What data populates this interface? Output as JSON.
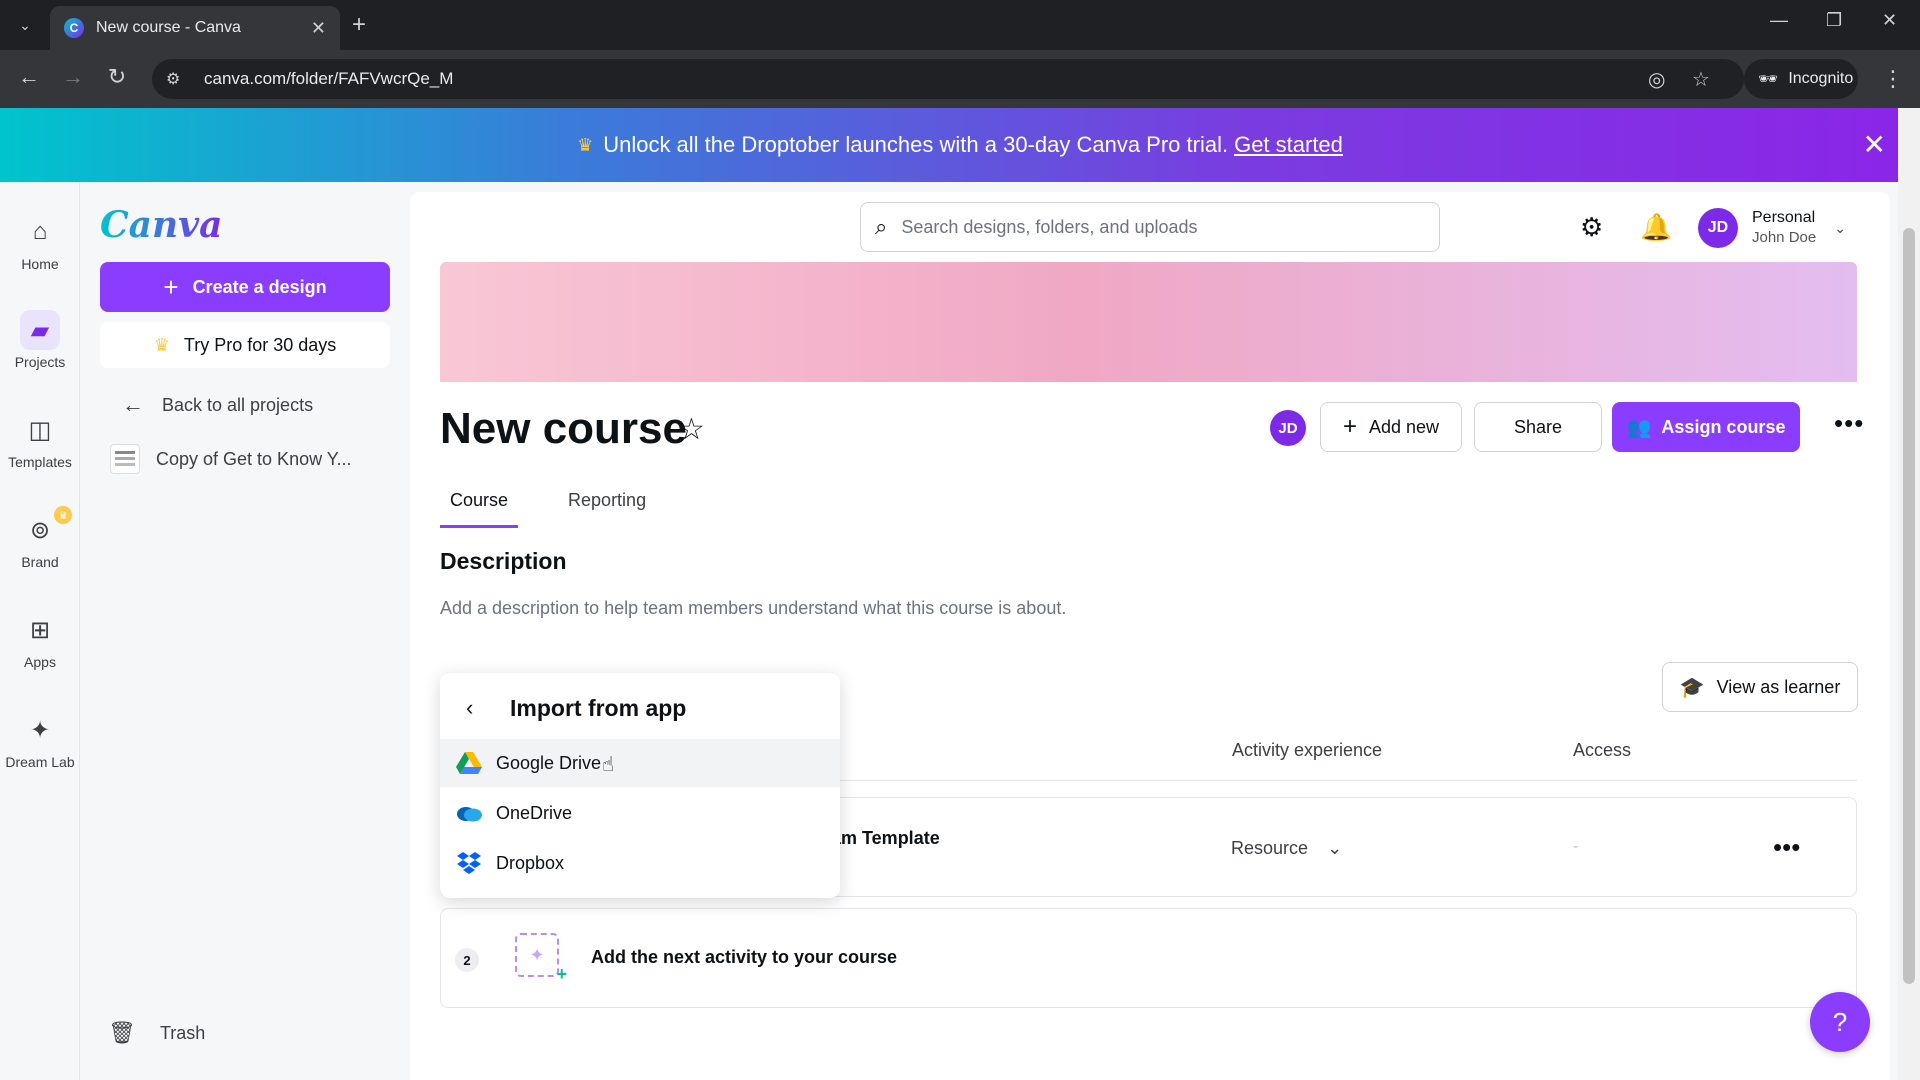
{
  "browser": {
    "tab_title": "New course - Canva",
    "favicon_letter": "C",
    "url": "canva.com/folder/FAFVwcrQe_M",
    "incognito_label": "Incognito"
  },
  "promo": {
    "text": "Unlock all the Droptober launches with a 30-day Canva Pro trial.",
    "link": "Get started"
  },
  "rail": {
    "items": [
      {
        "label": "Home",
        "icon": "home-icon"
      },
      {
        "label": "Projects",
        "icon": "folder-icon"
      },
      {
        "label": "Templates",
        "icon": "templates-icon"
      },
      {
        "label": "Brand",
        "icon": "brand-icon"
      },
      {
        "label": "Apps",
        "icon": "apps-icon"
      },
      {
        "label": "Dream Lab",
        "icon": "dream-lab-icon"
      }
    ]
  },
  "side": {
    "logo": "Canva",
    "create_label": "Create a design",
    "pro_label": "Try Pro for 30 days",
    "back_label": "Back to all projects",
    "project_item": "Copy of Get to Know Y...",
    "trash_label": "Trash"
  },
  "header": {
    "search_placeholder": "Search designs, folders, and uploads",
    "account_type": "Personal",
    "user_name": "John Doe",
    "avatar_initials": "JD"
  },
  "course": {
    "title": "New course",
    "add_new_label": "Add new",
    "share_label": "Share",
    "assign_label": "Assign course",
    "tabs": [
      "Course",
      "Reporting"
    ],
    "description_heading": "Description",
    "description_text": "Add a description to help team members understand what this course is about.",
    "view_as_learner": "View as learner",
    "columns": {
      "activity": "Activity experience",
      "access": "Access"
    },
    "row1": {
      "title_partial": "am Template",
      "experience": "Resource",
      "access": "-"
    },
    "row2": {
      "number": "2",
      "text": "Add the next activity to your course"
    }
  },
  "import_menu": {
    "heading": "Import from app",
    "items": [
      {
        "label": "Google Drive",
        "icon": "google-drive-icon"
      },
      {
        "label": "OneDrive",
        "icon": "onedrive-icon"
      },
      {
        "label": "Dropbox",
        "icon": "dropbox-icon"
      }
    ]
  },
  "help_label": "?",
  "colors": {
    "accent": "#8b3dff",
    "brand_teal": "#00c4cc"
  }
}
